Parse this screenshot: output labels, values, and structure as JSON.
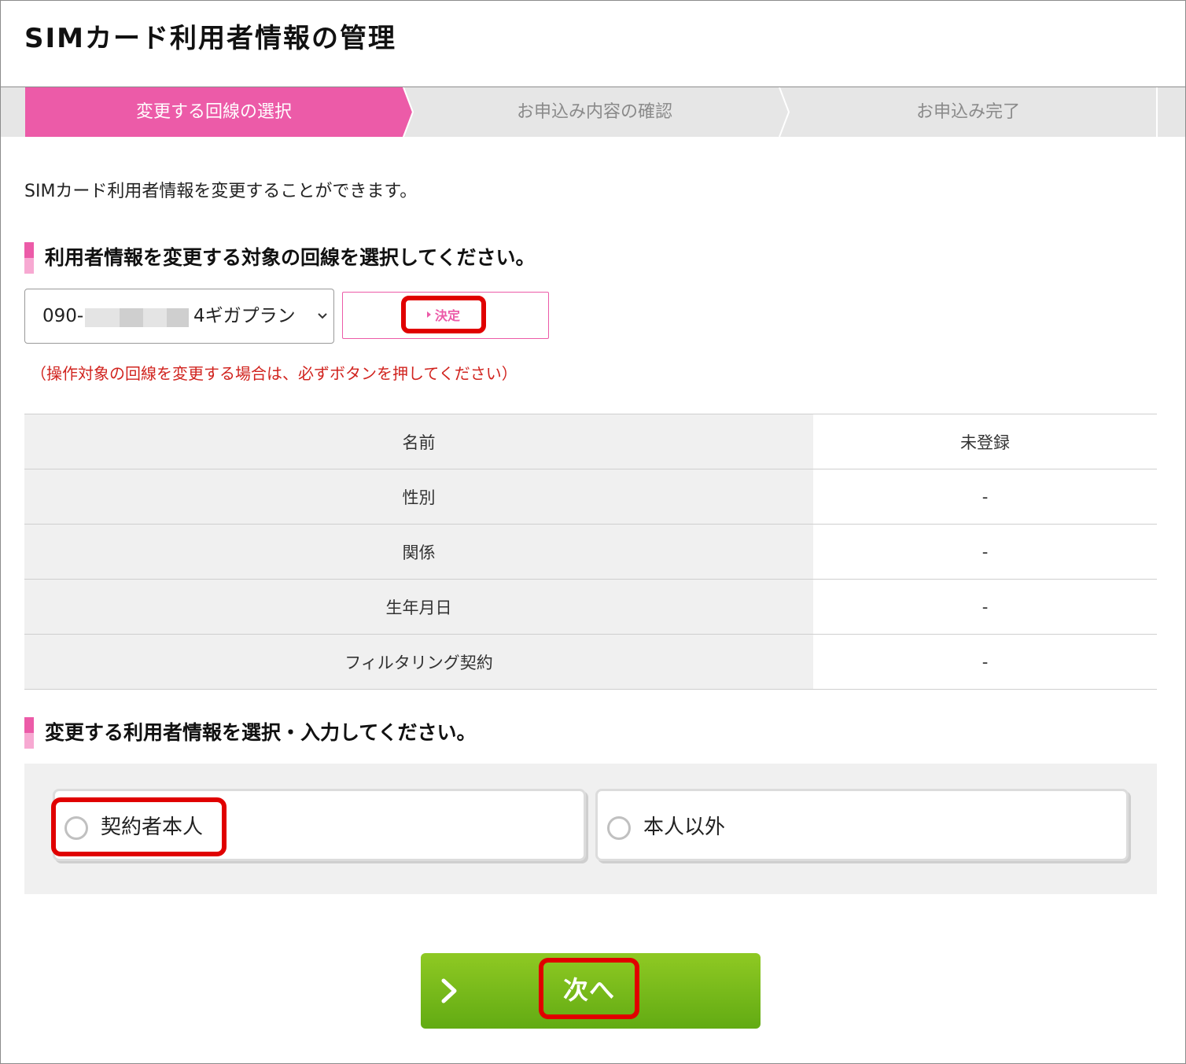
{
  "page": {
    "title": "SIMカード利用者情報の管理",
    "intro": "SIMカード利用者情報を変更することができます。"
  },
  "steps": [
    {
      "label": "変更する回線の選択",
      "active": true
    },
    {
      "label": "お申込み内容の確認",
      "active": false
    },
    {
      "label": "お申込み完了",
      "active": false
    }
  ],
  "section1": {
    "heading": "利用者情報を変更する対象の回線を選択してください。",
    "select": {
      "number_prefix": "090-",
      "plan": "4ギガプラン"
    },
    "decide_label": "決定",
    "notice": "（操作対象の回線を変更する場合は、必ずボタンを押してください）"
  },
  "table": [
    {
      "label": "名前",
      "value": "未登録"
    },
    {
      "label": "性別",
      "value": "-"
    },
    {
      "label": "関係",
      "value": "-"
    },
    {
      "label": "生年月日",
      "value": "-"
    },
    {
      "label": "フィルタリング契約",
      "value": "-"
    }
  ],
  "section2": {
    "heading": "変更する利用者情報を選択・入力してください。",
    "options": [
      {
        "label": "契約者本人",
        "selected": false
      },
      {
        "label": "本人以外",
        "selected": false
      }
    ]
  },
  "next_button": {
    "label": "次へ"
  },
  "colors": {
    "accent": "#ec5ba8",
    "highlight": "#e00000",
    "button_green": "#7bbd1b",
    "notice_red": "#d1241f"
  }
}
